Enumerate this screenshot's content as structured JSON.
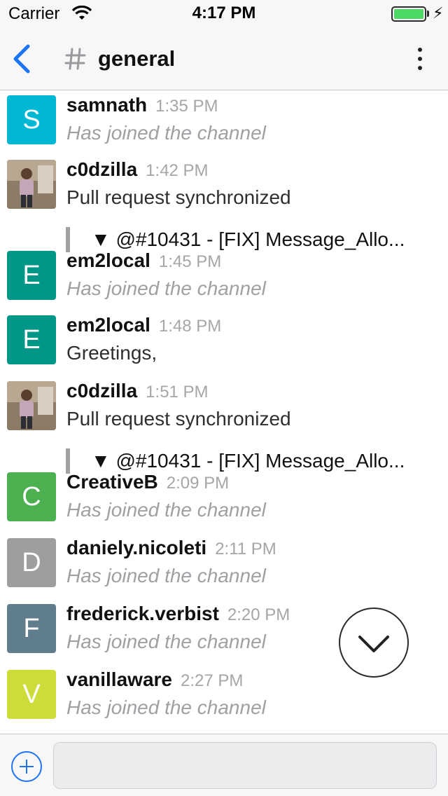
{
  "status_bar": {
    "carrier": "Carrier",
    "time": "4:17 PM",
    "battery_level": 1.0
  },
  "header": {
    "channel_name": "general",
    "back_icon": "chevron-left-icon",
    "channel_icon": "hash-icon",
    "menu_icon": "kebab-menu-icon"
  },
  "colors": {
    "accent": "#1d74f5",
    "battery": "#4cd964",
    "system_text": "#a0a0a4"
  },
  "messages": [
    {
      "user": "samnath",
      "time": "1:35 PM",
      "text": "Has joined the channel",
      "system": true,
      "avatar_letter": "S",
      "avatar_color": "#00b8d4"
    },
    {
      "user": "c0dzilla",
      "time": "1:42 PM",
      "text": "Pull request synchronized",
      "system": false,
      "avatar_photo": true,
      "attachment": "▼ @#10431 - [FIX] Message_Allo..."
    },
    {
      "user": "em2local",
      "time": "1:45 PM",
      "text": "Has joined the channel",
      "system": true,
      "avatar_letter": "E",
      "avatar_color": "#009688"
    },
    {
      "user": "em2local",
      "time": "1:48 PM",
      "text": "Greetings,",
      "system": false,
      "avatar_letter": "E",
      "avatar_color": "#009688"
    },
    {
      "user": "c0dzilla",
      "time": "1:51 PM",
      "text": "Pull request synchronized",
      "system": false,
      "avatar_photo": true,
      "attachment": "▼ @#10431 - [FIX] Message_Allo..."
    },
    {
      "user": "CreativeB",
      "time": "2:09 PM",
      "text": "Has joined the channel",
      "system": true,
      "avatar_letter": "C",
      "avatar_color": "#4caf50"
    },
    {
      "user": "daniely.nicoleti",
      "time": "2:11 PM",
      "text": "Has joined the channel",
      "system": true,
      "avatar_letter": "D",
      "avatar_color": "#9e9e9e"
    },
    {
      "user": "frederick.verbist",
      "time": "2:20 PM",
      "text": "Has joined the channel",
      "system": true,
      "avatar_letter": "F",
      "avatar_color": "#607d8b"
    },
    {
      "user": "vanillaware",
      "time": "2:27 PM",
      "text": "Has joined the channel",
      "system": true,
      "avatar_letter": "V",
      "avatar_color": "#cddc39"
    }
  ],
  "scroll_button_icon": "chevron-down-icon",
  "composer": {
    "add_icon": "plus-icon",
    "input_value": "",
    "input_placeholder": ""
  }
}
